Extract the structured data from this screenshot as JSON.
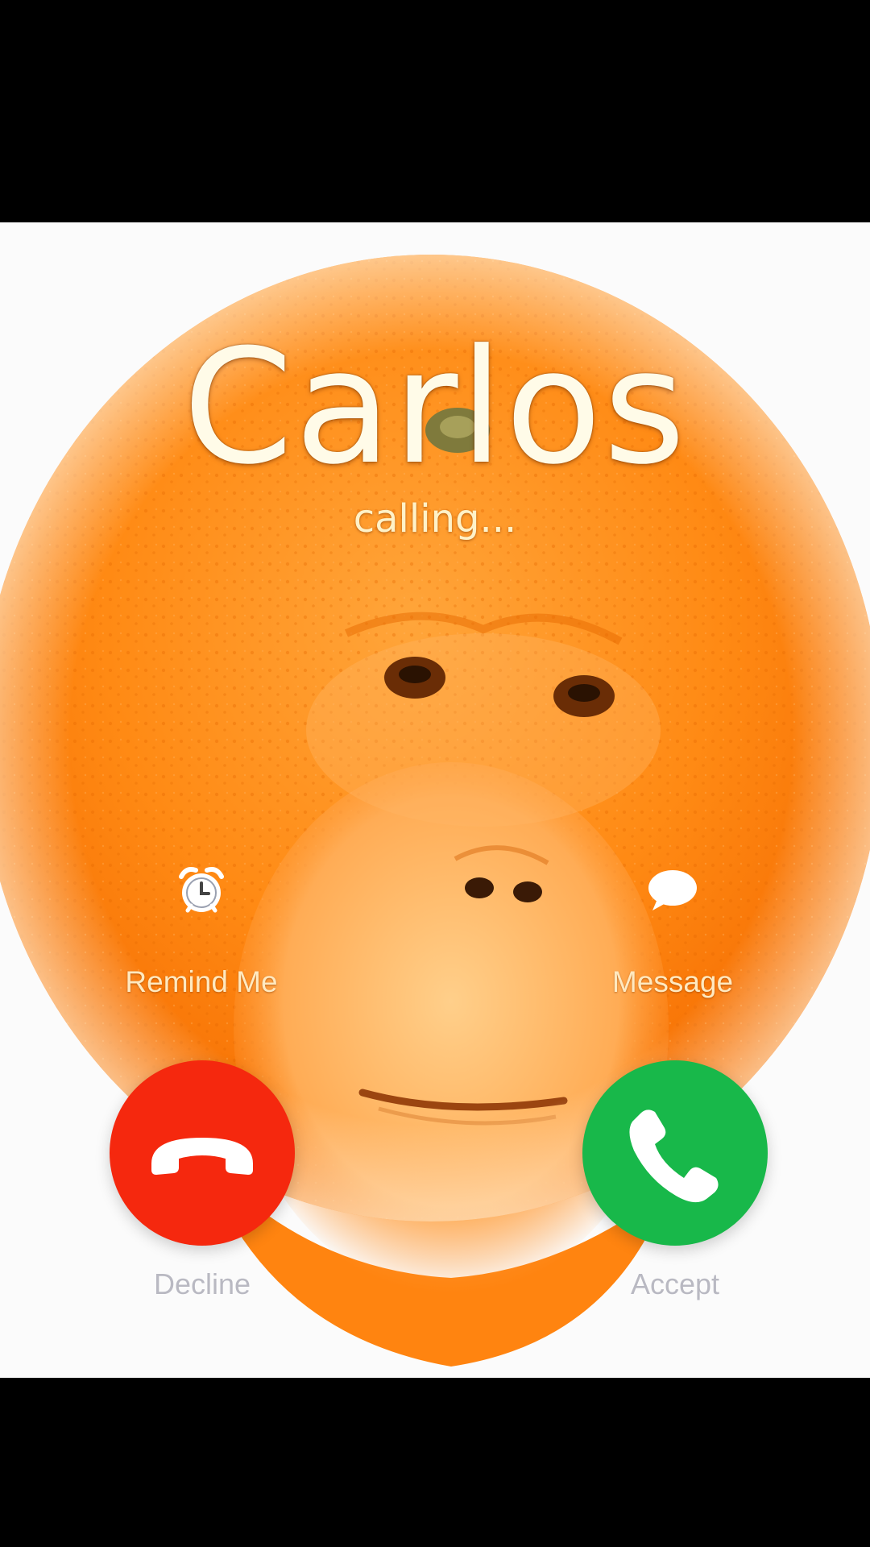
{
  "call": {
    "caller_name": "Carlos",
    "status": "calling..."
  },
  "quick_actions": {
    "remind": {
      "label": "Remind Me",
      "icon": "alarm-clock-icon"
    },
    "message": {
      "label": "Message",
      "icon": "speech-bubble-icon"
    }
  },
  "buttons": {
    "decline": {
      "label": "Decline",
      "icon": "hang-up-phone-icon",
      "color": "#f5280e"
    },
    "accept": {
      "label": "Accept",
      "icon": "phone-icon",
      "color": "#18b84a"
    }
  },
  "wallpaper": {
    "subject": "orange-fruit-with-orangutan-face"
  }
}
